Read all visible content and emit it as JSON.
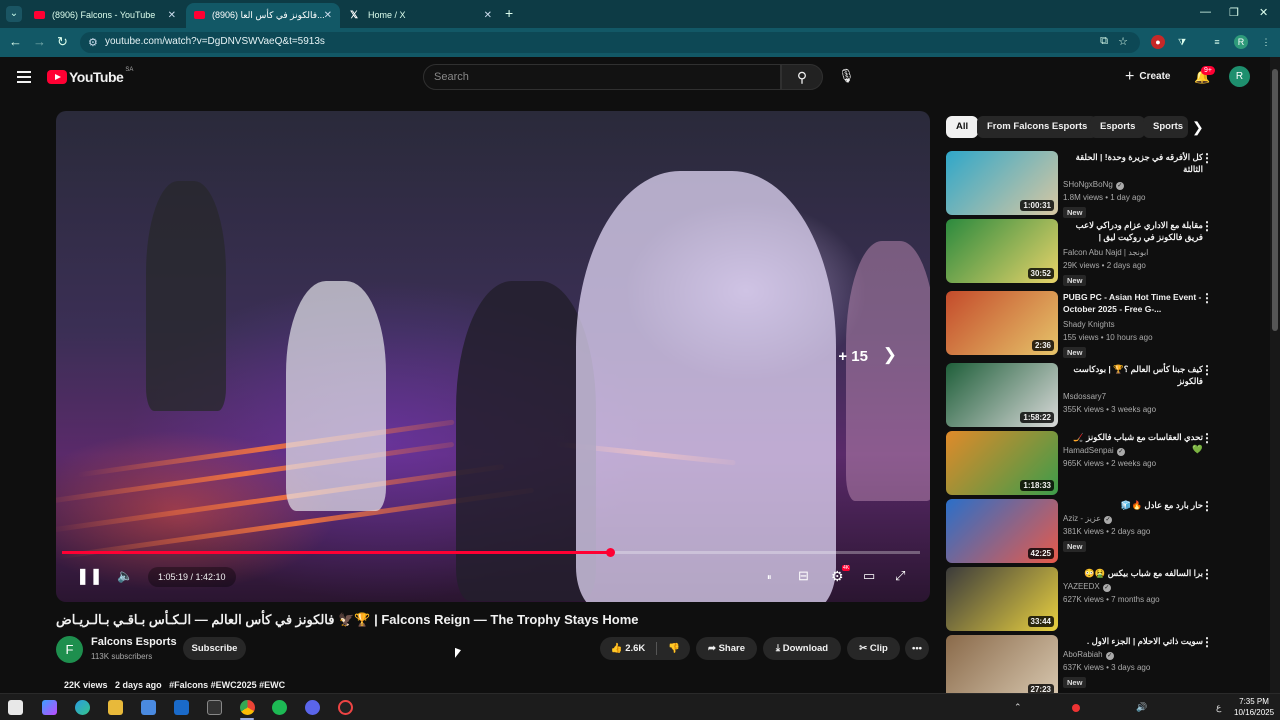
{
  "browser": {
    "tabs": [
      {
        "label": "(8906) Falcons - YouTube",
        "icon": "youtube-icon"
      },
      {
        "label": "(8906) فالكونز في كأس العا...",
        "icon": "youtube-icon"
      },
      {
        "label": "Home / X",
        "icon": "x-icon"
      }
    ],
    "url": "youtube.com/watch?v=DgDNVSWVaeQ&t=5913s",
    "profile_initial": "R"
  },
  "header": {
    "logo_text": "YouTube",
    "country_code": "SA",
    "search_placeholder": "Search",
    "create_label": "Create",
    "notification_badge": "9+",
    "avatar_initial": "R"
  },
  "player": {
    "current_time": "1:05:19",
    "total_time": "1:42:10",
    "time_display": "1:05:19 / 1:42:10",
    "progress_fraction": 0.639,
    "next_count": "+ 15",
    "settings_badge": "4K"
  },
  "video": {
    "title": "فالكونز في كأس العالم — الـكـأس بـاقـي بـالـريـاض 🦅🏆 | Falcons Reign — The Trophy Stays Home",
    "channel_name": "Falcons Esports",
    "channel_initial": "F",
    "subscribers": "113K subscribers",
    "subscribe_label": "Subscribe",
    "likes": "2.6K",
    "share_label": "Share",
    "download_label": "Download",
    "clip_label": "Clip",
    "views": "22K views",
    "age": "2 days ago",
    "tags": "#Falcons #EWC2025 #EWC"
  },
  "chips": [
    "All",
    "From Falcons Esports",
    "Esports",
    "Sports"
  ],
  "recommendations": [
    {
      "title": "كل الأفرقه في جزيرة وحدة! | الحلقة الثالثة",
      "channel": "SHoNgxBoNg",
      "verified": true,
      "views": "1.8M views • 1 day ago",
      "badge": "New",
      "duration": "1:00:31",
      "c1": "#2fa7c9",
      "c2": "#d8c7a2"
    },
    {
      "title": "مقابلة مع الاداري عزام ودراكي لاعب فريق فالكونز في روكيت ليق | Interview with ...",
      "channel": "Falcon Abu Najd | ابونجد",
      "verified": false,
      "views": "29K views • 2 days ago",
      "badge": "New",
      "duration": "30:52",
      "c1": "#2b8a3e",
      "c2": "#e8d36a"
    },
    {
      "title": "PUBG PC - Asian Hot Time Event - October 2025 - Free G-...",
      "channel": "Shady Knights",
      "verified": false,
      "views": "155 views • 10 hours ago",
      "badge": "New",
      "duration": "2:36",
      "c1": "#c44b2b",
      "c2": "#e6c46a"
    },
    {
      "title": "كيف جبنا كأس العالم ؟🏆 | بودكاست فالكونز",
      "channel": "Msdossary7",
      "verified": false,
      "views": "355K views • 3 weeks ago",
      "badge": "",
      "duration": "1:58:22",
      "c1": "#1f5f3a",
      "c2": "#d9d9d9"
    },
    {
      "title": "تحدي العقاسات مع شباب فالكونز 🏒💚",
      "channel": "HamadSenpai",
      "verified": true,
      "views": "965K views • 2 weeks ago",
      "badge": "",
      "duration": "1:18:33",
      "c1": "#e08a2a",
      "c2": "#3c9c4a"
    },
    {
      "title": "حار بارد مع عادل 🔥🧊",
      "channel": "Aziz - عزيز",
      "verified": true,
      "views": "381K views • 2 days ago",
      "badge": "New",
      "duration": "42:25",
      "c1": "#2a6fc9",
      "c2": "#e85a4a"
    },
    {
      "title": "برا السالفه مع شباب بيكس 🤮😳",
      "channel": "YAZEEDX",
      "verified": true,
      "views": "627K views • 7 months ago",
      "badge": "",
      "duration": "33:44",
      "c1": "#3b3b3b",
      "c2": "#e8d040"
    },
    {
      "title": "سويت ذاتي الاحلام | الجزء الاول .",
      "channel": "AboRabiah",
      "verified": true,
      "views": "637K views • 3 days ago",
      "badge": "New",
      "duration": "27:23",
      "c1": "#8a6a4a",
      "c2": "#d8c8b0"
    }
  ],
  "taskbar": {
    "time": "7:35 PM",
    "date": "10/16/2025",
    "lang": "ع"
  },
  "colors": {
    "accent": "#ff0033",
    "browser_frame": "#0d3b45",
    "background": "#0f0f0f"
  }
}
